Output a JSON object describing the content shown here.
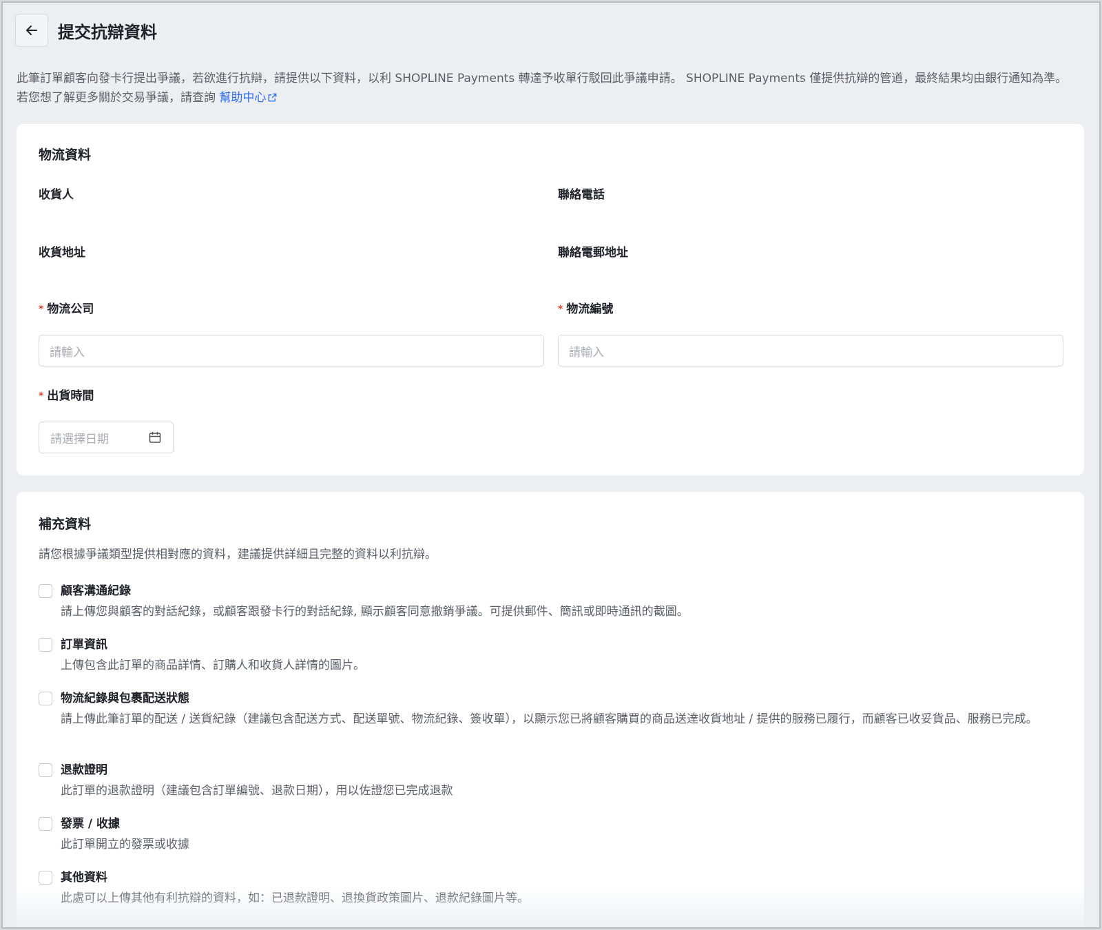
{
  "header": {
    "title": "提交抗辯資料",
    "back_icon": "arrow-left-icon"
  },
  "intro": {
    "text": "此筆訂單顧客向發卡行提出爭議，若欲進行抗辯，請提供以下資料，以利 SHOPLINE Payments 轉達予收單行駁回此爭議申請。 SHOPLINE Payments 僅提供抗辯的管道，最終結果均由銀行通知為準。 若您想了解更多關於交易爭議，請查詢",
    "link_label": "幫助中心",
    "link_icon": "external-link-icon",
    "link_color": "#2a6df4"
  },
  "logistics": {
    "title": "物流資料",
    "recipient_label": "收貨人",
    "phone_label": "聯絡電話",
    "address_label": "收貨地址",
    "email_label": "聯絡電郵地址",
    "carrier_label": "物流公司",
    "carrier_placeholder": "請輸入",
    "tracking_label": "物流編號",
    "tracking_placeholder": "請輸入",
    "ship_time_label": "出貨時間",
    "ship_time_placeholder": "請選擇日期",
    "required_mark": "*",
    "required_color": "#e5482f",
    "calendar_icon": "calendar-icon"
  },
  "supplement": {
    "title": "補充資料",
    "description": "請您根據爭議類型提供相對應的資料，建議提供詳細且完整的資料以利抗辯。",
    "options": [
      {
        "title": "顧客溝通紀錄",
        "desc": "請上傳您與顧客的對話紀錄，或顧客跟發卡行的對話紀錄, 顯示顧客同意撤銷爭議。可提供郵件、簡訊或即時通訊的截圖。",
        "checked": false
      },
      {
        "title": "訂單資訊",
        "desc": "上傳包含此訂單的商品詳情、訂購人和收貨人詳情的圖片。",
        "checked": false
      },
      {
        "title": "物流紀錄與包裹配送狀態",
        "desc": "請上傳此筆訂單的配送 / 送貨紀錄（建議包含配送方式、配送單號、物流紀錄、簽收單），以顯示您已將顧客購買的商品送達收貨地址 / 提供的服務已履行，而顧客已收妥貨品、服務已完成。",
        "checked": false
      },
      {
        "title": "退款證明",
        "desc": "此訂單的退款證明（建議包含訂單編號、退款日期），用以佐證您已完成退款",
        "checked": false
      },
      {
        "title": "發票 / 收據",
        "desc": "此訂單開立的發票或收據",
        "checked": false
      },
      {
        "title": "其他資料",
        "desc": "此處可以上傳其他有利抗辯的資料，如：已退款證明、退換貨政策圖片、退款紀錄圖片等。",
        "checked": false
      }
    ]
  }
}
